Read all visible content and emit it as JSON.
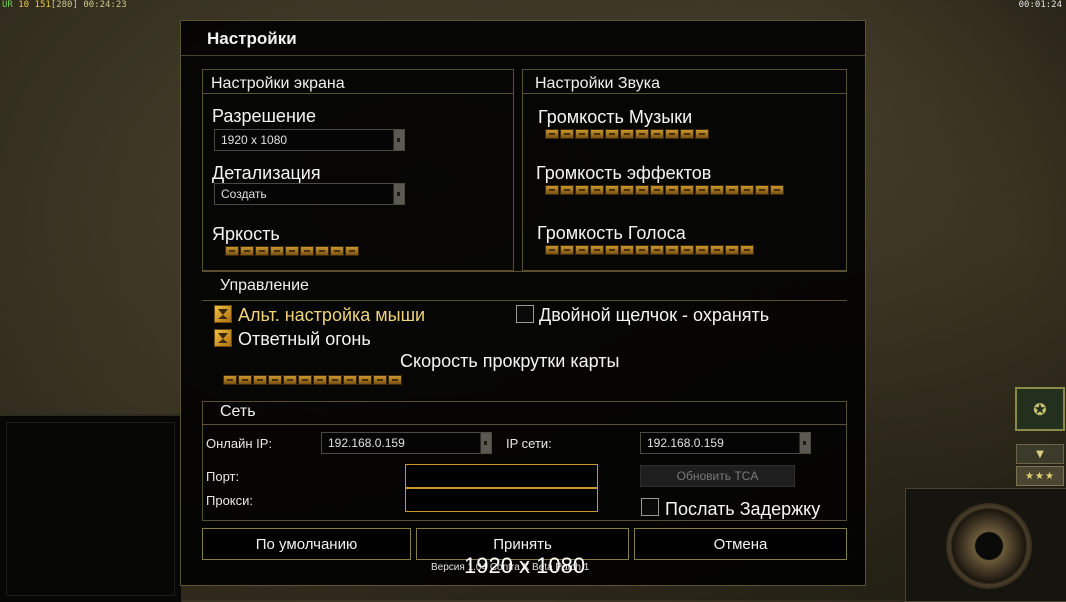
{
  "hud": {
    "tl_label": "UR",
    "tl_val1": "10",
    "tl_val2": "151",
    "tl_val3": "[280]",
    "tl_time": "00:24:23",
    "tr_time": "00:01:24"
  },
  "dialog": {
    "title": "Настройки",
    "screen": {
      "title": "Настройки экрана",
      "resolution_label": "Разрешение",
      "resolution_value": "1920 x 1080",
      "detail_label": "Детализация",
      "detail_value": "Создать",
      "brightness_label": "Яркость",
      "brightness_level": 9
    },
    "sound": {
      "title": "Настройки Звука",
      "music_label": "Громкость Музыки",
      "music_level": 11,
      "effects_label": "Громкость эффектов",
      "effects_level": 16,
      "voice_label": "Громкость Голоса",
      "voice_level": 14
    },
    "control": {
      "title": "Управление",
      "alt_mouse_label": "Альт. настройка мыши",
      "alt_mouse_checked": true,
      "double_click_label": "Двойной щелчок - охранять",
      "double_click_checked": false,
      "return_fire_label": "Ответный огонь",
      "return_fire_checked": true,
      "scroll_speed_label": "Скорость прокрутки карты",
      "scroll_speed_level": 12
    },
    "network": {
      "title": "Сеть",
      "online_ip_label": "Онлайн IP:",
      "online_ip_value": "192.168.0.159",
      "lan_ip_label": "IP сети:",
      "lan_ip_value": "192.168.0.159",
      "port_label": "Порт:",
      "proxy_label": "Прокси:",
      "update_tca_label": "Обновить TCA",
      "send_delay_label": "Послать Задержку",
      "send_delay_checked": false
    },
    "buttons": {
      "defaults": "По умолчанию",
      "accept": "Принять",
      "cancel": "Отмена"
    },
    "version": "Версия 1.04 Contra X Beta Patch 1",
    "resolution_overlay": "1920 x 1080"
  },
  "side": {
    "stars": "★★★",
    "arrow": "▼"
  }
}
